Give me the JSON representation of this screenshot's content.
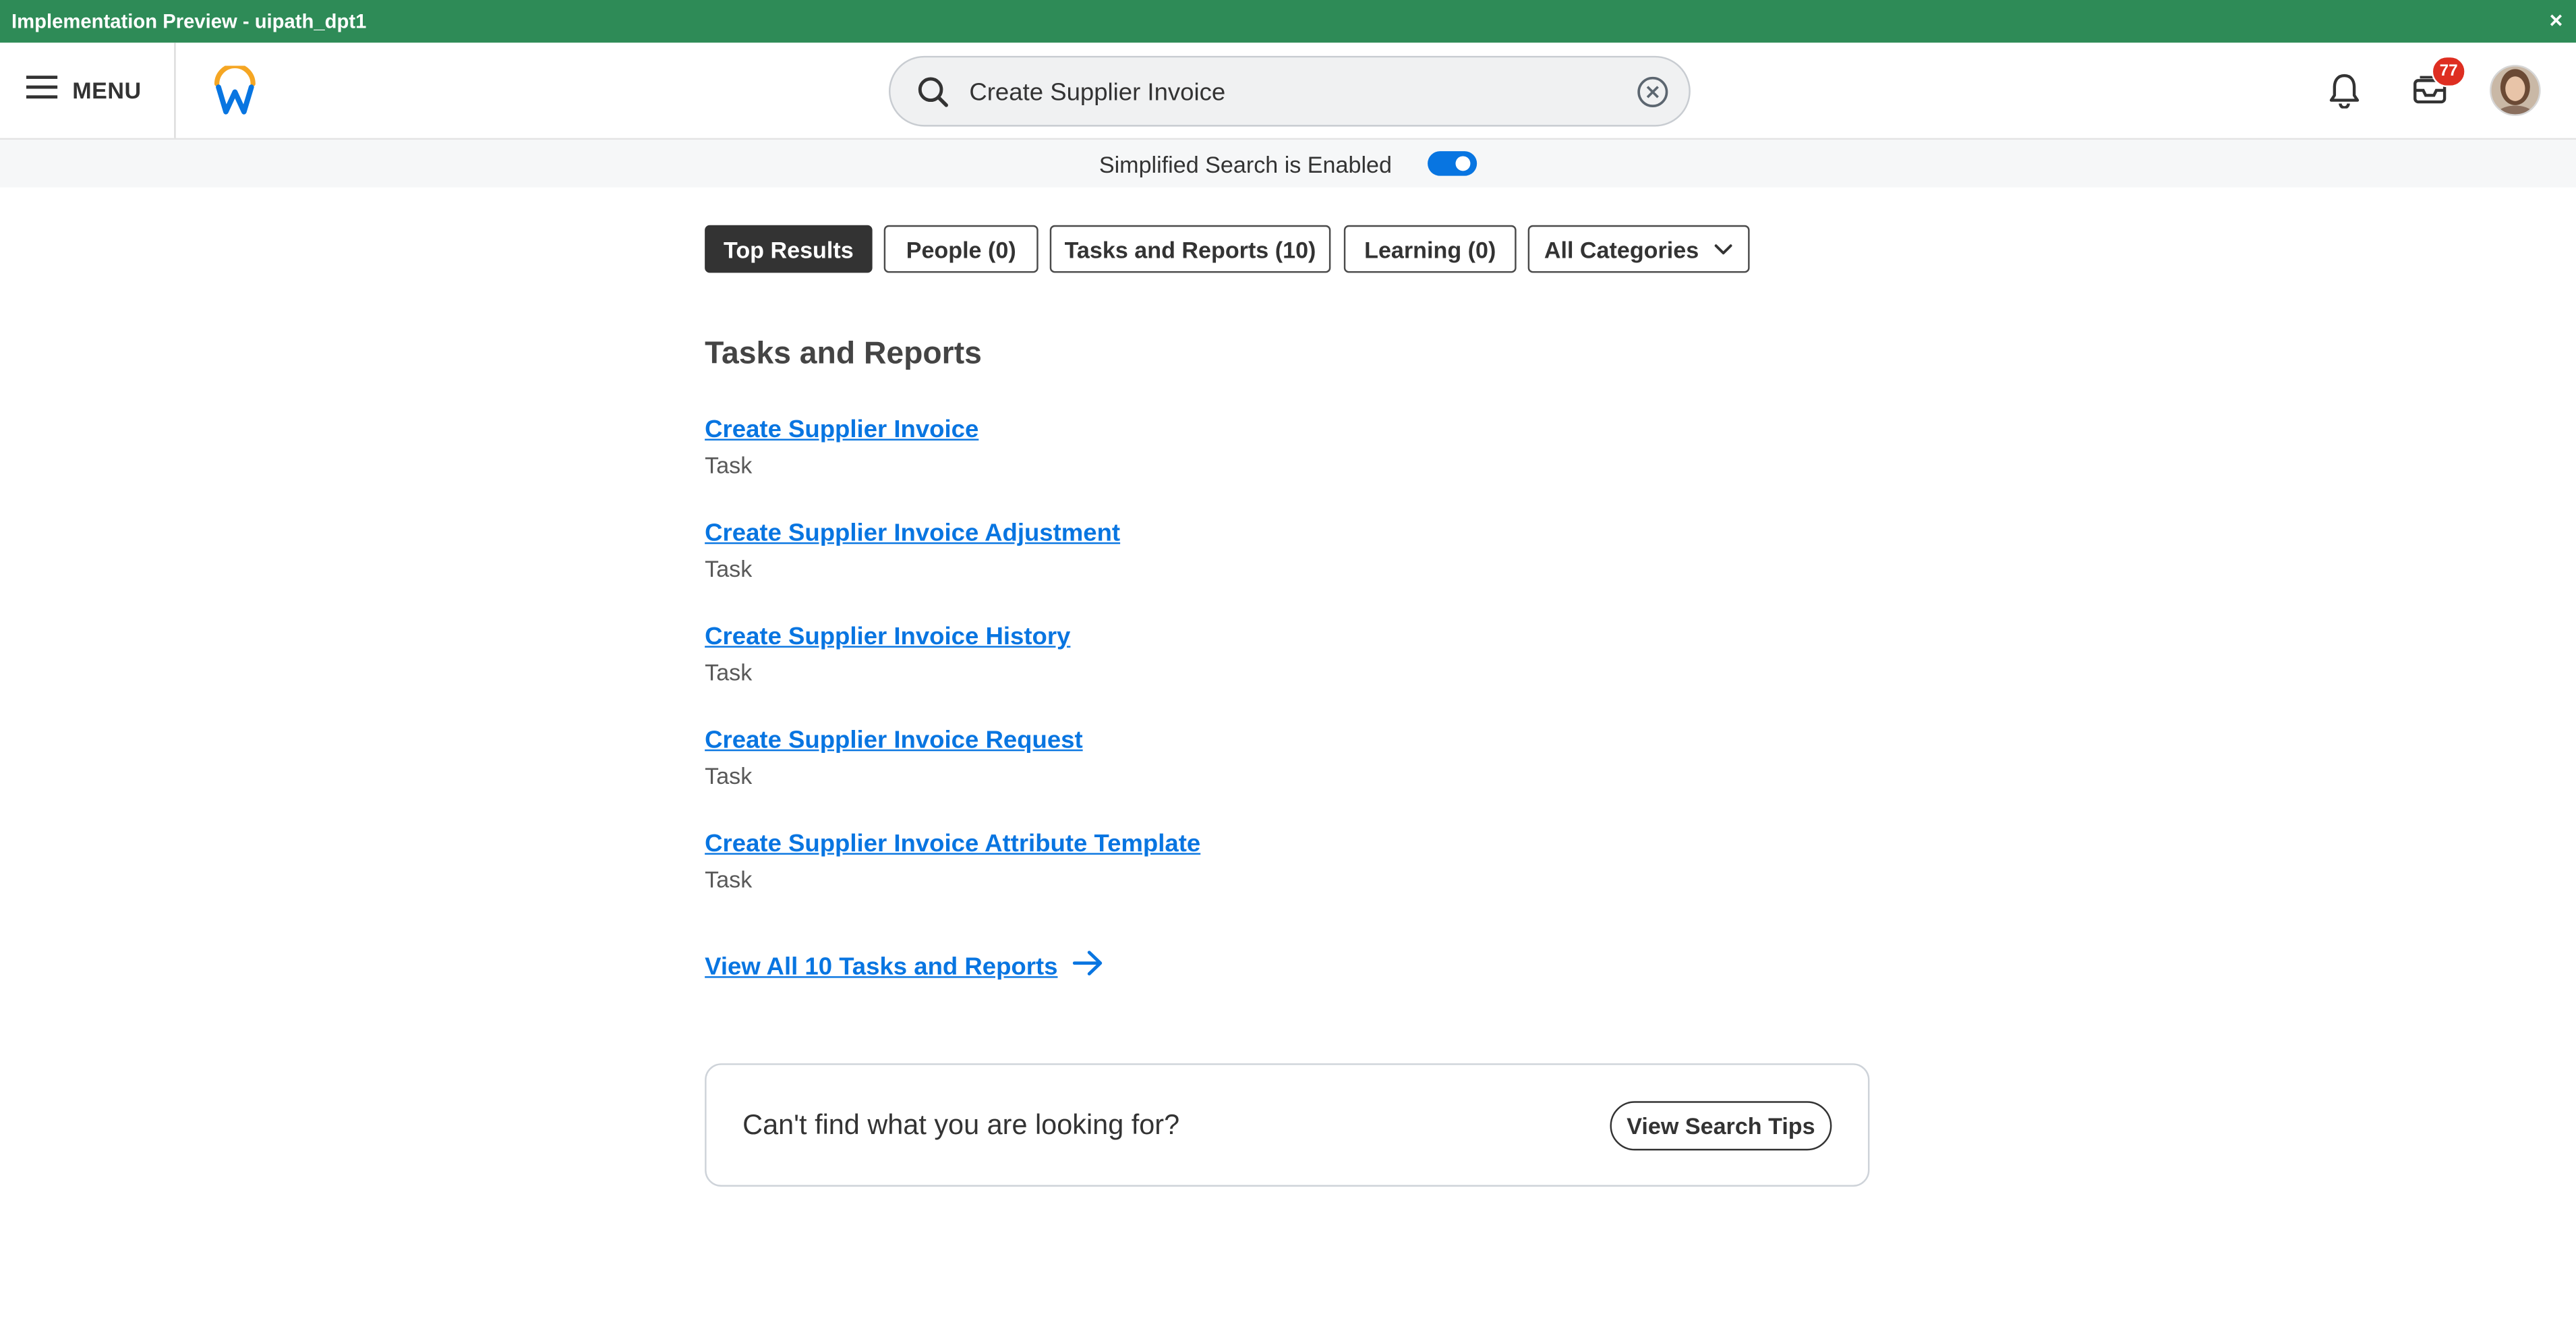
{
  "banner": {
    "title": "Implementation Preview -  uipath_dpt1",
    "close_glyph": "×"
  },
  "header": {
    "menu_label": "MENU",
    "search_value": "Create Supplier Invoice",
    "inbox_count": "77"
  },
  "simplified_search": {
    "label": "Simplified Search is Enabled",
    "enabled": true
  },
  "filters": [
    {
      "label": "Top Results",
      "active": true
    },
    {
      "label": "People (0)",
      "active": false
    },
    {
      "label": "Tasks and Reports (10)",
      "active": false
    },
    {
      "label": "Learning (0)",
      "active": false
    },
    {
      "label": "All Categories",
      "active": false
    }
  ],
  "section": {
    "title": "Tasks and Reports"
  },
  "results": [
    {
      "title": "Create Supplier Invoice",
      "type": "Task"
    },
    {
      "title": "Create Supplier Invoice Adjustment",
      "type": "Task"
    },
    {
      "title": "Create Supplier Invoice History",
      "type": "Task"
    },
    {
      "title": "Create Supplier Invoice Request",
      "type": "Task"
    },
    {
      "title": "Create Supplier Invoice Attribute Template",
      "type": "Task"
    }
  ],
  "view_all_label": "View All 10 Tasks and Reports",
  "help_card": {
    "text": "Can't find what you are looking for?",
    "button_label": "View Search Tips"
  },
  "colors": {
    "banner": "#2e8b57",
    "link": "#0875e1",
    "badge": "#de2e21",
    "active_pill": "#333333"
  },
  "icons": [
    "hamburger-icon",
    "workday-logo",
    "search-icon",
    "clear-icon",
    "bell-icon",
    "inbox-icon",
    "avatar",
    "arrow-right-icon",
    "chevron-down-icon"
  ]
}
